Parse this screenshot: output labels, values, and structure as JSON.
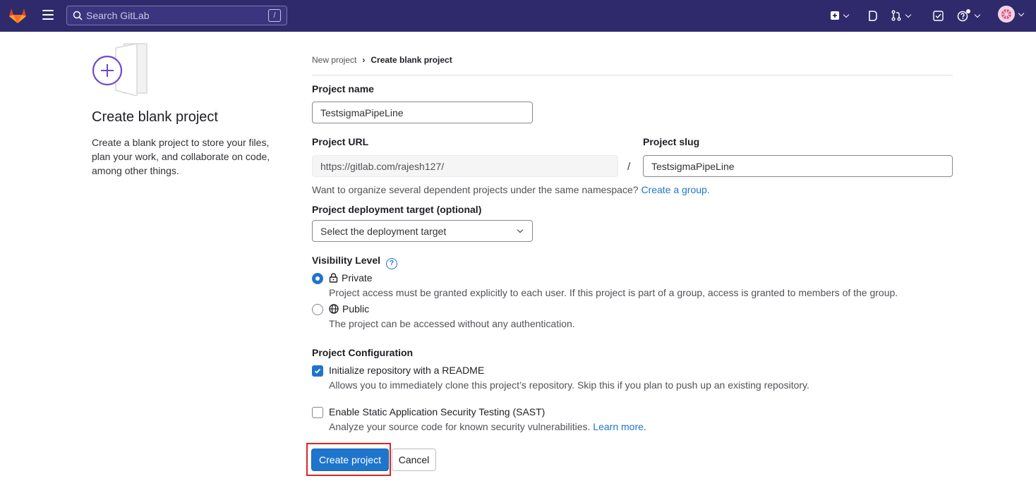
{
  "header": {
    "search_placeholder": "Search GitLab",
    "search_shortcut": "/"
  },
  "sidebar": {
    "title": "Create blank project",
    "description": "Create a blank project to store your files, plan your work, and collaborate on code, among other things."
  },
  "breadcrumb": {
    "parent": "New project",
    "current": "Create blank project"
  },
  "form": {
    "project_name_label": "Project name",
    "project_name_value": "TestsigmaPipeLine",
    "project_url_label": "Project URL",
    "project_url_value": "https://gitlab.com/rajesh127/",
    "separator": "/",
    "project_slug_label": "Project slug",
    "project_slug_value": "TestsigmaPipeLine",
    "namespace_help": "Want to organize several dependent projects under the same namespace?",
    "create_group_link": "Create a group.",
    "deployment_label": "Project deployment target (optional)",
    "deployment_value": "Select the deployment target",
    "visibility_label": "Visibility Level",
    "visibility_options": [
      {
        "label": "Private",
        "description": "Project access must be granted explicitly to each user. If this project is part of a group, access is granted to members of the group.",
        "selected": true
      },
      {
        "label": "Public",
        "description": "The project can be accessed without any authentication.",
        "selected": false
      }
    ],
    "config_label": "Project Configuration",
    "config_options": [
      {
        "label": "Initialize repository with a README",
        "description": "Allows you to immediately clone this project’s repository. Skip this if you plan to push up an existing repository.",
        "checked": true
      },
      {
        "label": "Enable Static Application Security Testing (SAST)",
        "description": "Analyze your source code for known security vulnerabilities.",
        "link": "Learn more.",
        "checked": false
      }
    ],
    "create_button": "Create project",
    "cancel_button": "Cancel"
  },
  "colors": {
    "navbar": "#2f2a6b",
    "primary": "#1f75cb",
    "highlight": "#d7262a"
  }
}
